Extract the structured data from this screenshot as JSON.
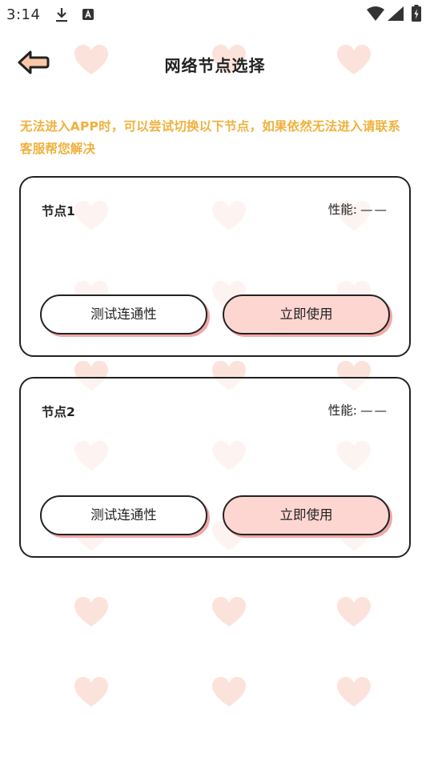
{
  "status_bar": {
    "time": "3:14"
  },
  "header": {
    "title": "网络节点选择"
  },
  "notice": "无法进入APP时，可以尝试切换以下节点，如果依然无法进入请联系客服帮您解决",
  "nodes": [
    {
      "name": "节点1",
      "performance_label": "性能:",
      "performance_value": "——",
      "test_button": "测试连通性",
      "use_button": "立即使用"
    },
    {
      "name": "节点2",
      "performance_label": "性能:",
      "performance_value": "——",
      "test_button": "测试连通性",
      "use_button": "立即使用"
    }
  ],
  "colors": {
    "notice": "#f0b13c",
    "use_button_bg": "#fdd6d2",
    "button_shadow": "#f2a7a7",
    "heart": "#fbe3dc",
    "back_arrow": "#f9c8a8"
  },
  "icons": [
    "download-icon",
    "notification-icon",
    "wifi-icon",
    "signal-icon",
    "battery-icon",
    "back-arrow-icon",
    "heart-icon"
  ]
}
